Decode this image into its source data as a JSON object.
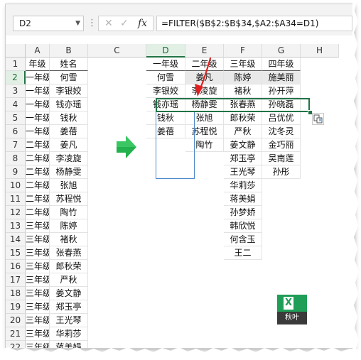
{
  "name_box": "D2",
  "formula": "=FILTER($B$2:$B$34,$A2:$A34=D1)",
  "fx_label": "fx",
  "col_headers": [
    "A",
    "B",
    "C",
    "D",
    "E",
    "F",
    "G",
    "H"
  ],
  "row_headers": [
    "1",
    "2",
    "3",
    "4",
    "5",
    "6",
    "7",
    "8",
    "9",
    "10",
    "11",
    "12",
    "13",
    "14",
    "15",
    "16",
    "17",
    "18",
    "19",
    "20",
    "21",
    "22"
  ],
  "selected_col": "D",
  "selected_row": "2",
  "source_table": {
    "headers": [
      "年级",
      "姓名"
    ],
    "rows": [
      [
        "一年级",
        "何雪"
      ],
      [
        "一年级",
        "李银姣"
      ],
      [
        "一年级",
        "钱亦瑶"
      ],
      [
        "一年级",
        "钱秋"
      ],
      [
        "一年级",
        "姜蓓"
      ],
      [
        "二年级",
        "姜凡"
      ],
      [
        "二年级",
        "李凌旋"
      ],
      [
        "二年级",
        "杨静雯"
      ],
      [
        "二年级",
        "张旭"
      ],
      [
        "二年级",
        "苏程悦"
      ],
      [
        "二年级",
        "陶竹"
      ],
      [
        "三年级",
        "陈婷"
      ],
      [
        "三年级",
        "褚秋"
      ],
      [
        "三年级",
        "张春燕"
      ],
      [
        "三年级",
        "郎秋荣"
      ],
      [
        "三年级",
        "严秋"
      ],
      [
        "三年级",
        "姜文静"
      ],
      [
        "三年级",
        "郑玉亭"
      ],
      [
        "三年级",
        "王光琴"
      ],
      [
        "三年级",
        "华莉莎"
      ],
      [
        "三年级",
        "蒋美娟"
      ]
    ]
  },
  "result_table": {
    "headers": [
      "一年级",
      "二年级",
      "三年级",
      "四年级"
    ],
    "columns": [
      [
        "何雪",
        "李银姣",
        "钱亦瑶",
        "钱秋",
        "姜蓓"
      ],
      [
        "姜凡",
        "李凌旋",
        "杨静雯",
        "张旭",
        "苏程悦",
        "陶竹"
      ],
      [
        "陈婷",
        "褚秋",
        "张春燕",
        "郎秋荣",
        "严秋",
        "姜文静",
        "郑玉亭",
        "王光琴",
        "华莉莎",
        "蒋美娟",
        "孙梦娇",
        "韩欣悦",
        "何含玉",
        "王二"
      ],
      [
        "施美丽",
        "孙开萍",
        "孙晓磊",
        "吕优优",
        "沈冬灵",
        "金巧丽",
        "吴南莲",
        "孙彤"
      ]
    ]
  },
  "logo_text": "秋叶",
  "logo_letter": "X",
  "colors": {
    "accent": "#217346",
    "arrow_green": "#22b14c",
    "red_arrow": "#e02020",
    "spill_gray": "#e9e9e9"
  }
}
